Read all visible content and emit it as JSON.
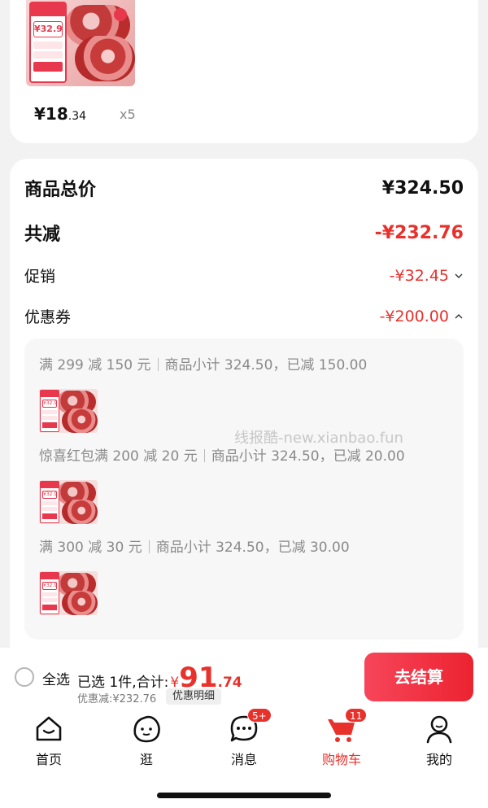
{
  "product": {
    "tag_price": "¥32.9",
    "price_int": "¥18",
    "price_dec": ".34",
    "quantity": "x5"
  },
  "summary": {
    "total_label": "商品总价",
    "total_value": "¥324.50",
    "reduce_label": "共减",
    "reduce_value": "-¥232.76",
    "promo_label": "促销",
    "promo_value": "-¥32.45",
    "coupon_label": "优惠券",
    "coupon_value": "-¥200.00"
  },
  "coupons": [
    {
      "name": "满 299 减 150 元",
      "detail": "商品小计 324.50，已减 150.00"
    },
    {
      "name": "惊喜红包满 200 减 20 元",
      "detail": "商品小计 324.50，已减 20.00"
    },
    {
      "name": "满 300 减 30 元",
      "detail": "商品小计 324.50，已减 30.00"
    }
  ],
  "watermark": "线报酷-new.xianbao.fun",
  "checkout": {
    "select_all": "全选",
    "selected": "已选 1件,合计:",
    "currency": "¥",
    "total_int": "91",
    "total_dec": ".74",
    "discount": "优惠减:¥232.76",
    "detail_button": "优惠明细",
    "go_button": "去结算"
  },
  "tabs": [
    {
      "label": "首页",
      "icon": "home-icon"
    },
    {
      "label": "逛",
      "icon": "browse-face-icon"
    },
    {
      "label": "消息",
      "icon": "message-icon",
      "badge": "5+"
    },
    {
      "label": "购物车",
      "icon": "cart-icon",
      "badge": "11",
      "active": true
    },
    {
      "label": "我的",
      "icon": "profile-icon"
    }
  ],
  "colors": {
    "accent": "#e8312b",
    "button_gradient_start": "#f7455a",
    "button_gradient_end": "#ec2330"
  }
}
